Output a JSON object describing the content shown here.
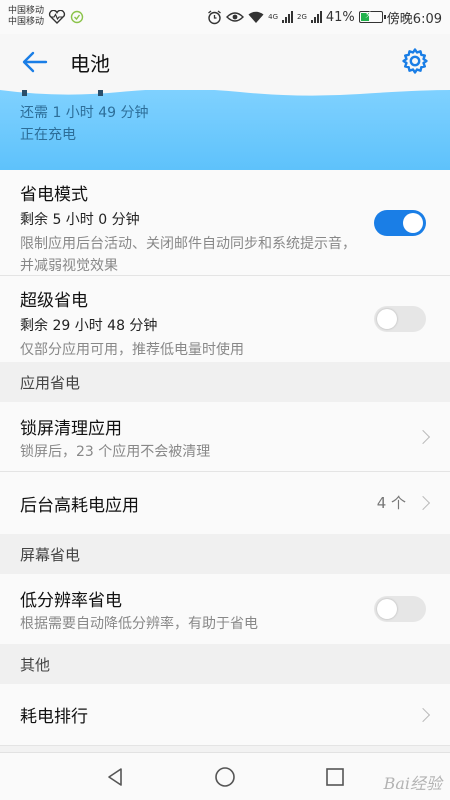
{
  "status_bar": {
    "carrier_1": "中国移动",
    "carrier_2": "中国移动",
    "network_1": "4G",
    "network_2": "2G",
    "battery_percent": "41%",
    "battery_level": 0.41,
    "time": "傍晚6:09",
    "icons": [
      "heart-rate-icon",
      "notification-icon",
      "alarm-icon",
      "eye-icon",
      "wifi-icon",
      "signal-icon",
      "battery-charging-icon"
    ]
  },
  "app_bar": {
    "title": "电池",
    "back_icon": "back-arrow-icon",
    "settings_icon": "gear-icon",
    "accent_color": "#1a7ee6"
  },
  "charging": {
    "remaining": "还需 1 小时 49 分钟",
    "status": "正在充电"
  },
  "power_saving": {
    "title": "省电模式",
    "remaining": "剩余 5 小时 0 分钟",
    "description": "限制应用后台活动、关闭邮件自动同步和系统提示音，并减弱视觉效果",
    "enabled": true
  },
  "ultra_saving": {
    "title": "超级省电",
    "remaining": "剩余 29 小时 48 分钟",
    "description": "仅部分应用可用，推荐低电量时使用",
    "enabled": false
  },
  "app_section": {
    "header": "应用省电",
    "lock_screen_cleanup": {
      "title": "锁屏清理应用",
      "description": "锁屏后，23 个应用不会被清理"
    },
    "background_high_power": {
      "title": "后台高耗电应用",
      "count": "4 个"
    }
  },
  "screen_section": {
    "header": "屏幕省电",
    "low_resolution": {
      "title": "低分辨率省电",
      "description": "根据需要自动降低分辨率，有助于省电",
      "enabled": false
    }
  },
  "other_section": {
    "header": "其他",
    "power_ranking": {
      "title": "耗电排行"
    }
  },
  "watermark": "Bai经验"
}
